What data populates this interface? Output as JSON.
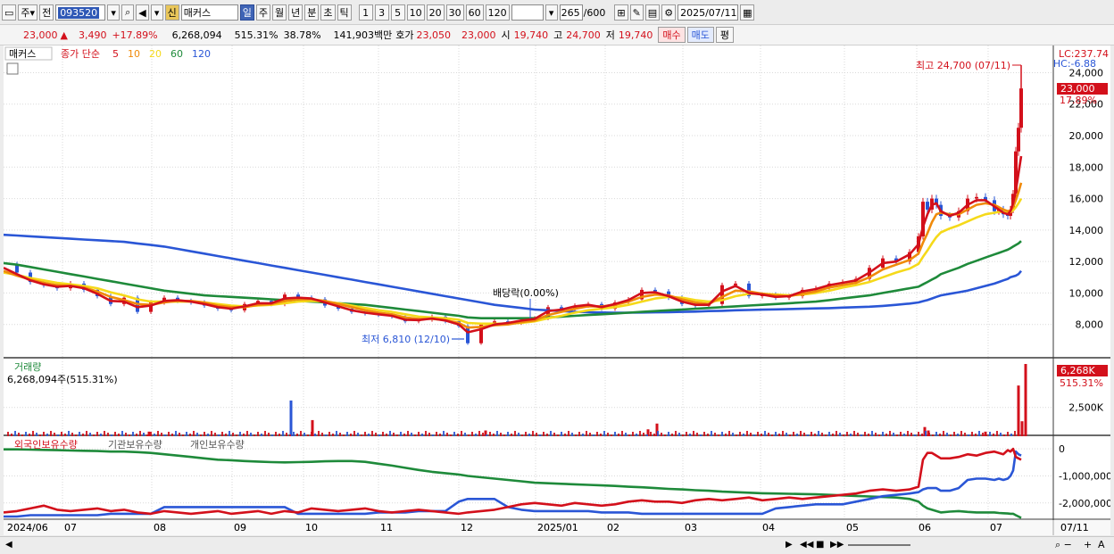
{
  "toolbar": {
    "mode": "주",
    "prev": "전",
    "code": "093520",
    "badge": "신",
    "name": "매커스",
    "periods": [
      "일",
      "주",
      "월",
      "년",
      "분",
      "초",
      "틱"
    ],
    "selected_period": "일",
    "intervals": [
      "1",
      "3",
      "5",
      "10",
      "20",
      "30",
      "60",
      "120"
    ],
    "count": "265",
    "count_max": "/600",
    "date": "2025/07/11"
  },
  "quote": {
    "price": "23,000",
    "change": "3,490",
    "change_pct": "+17.89%",
    "volume": "6,268,094",
    "vol_pct": "515.31%",
    "turnover": "38.78%",
    "amount": "141,903백만",
    "bid_label": "호가",
    "bid": "23,050",
    "ask": "23,000",
    "open_label": "시",
    "open": "19,740",
    "high_label": "고",
    "high": "24,700",
    "low_label": "저",
    "low": "19,740",
    "buy": "매수",
    "sell": "매도",
    "flat": "평"
  },
  "chart_data": {
    "type": "line",
    "price_panel": {
      "legend_name": "매커스",
      "legend_ma_title": "종가 단순",
      "ma_labels": [
        "5",
        "10",
        "20",
        "60",
        "120"
      ],
      "ma_colors": [
        "#d3101b",
        "#f08a0a",
        "#f5d91a",
        "#1e8a3a",
        "#2a56d6"
      ],
      "ylim": [
        6000,
        25500
      ],
      "y_ticks": [
        8000,
        10000,
        12000,
        14000,
        16000,
        18000,
        20000,
        22000,
        24000
      ],
      "y_tick_labels": [
        "8,000",
        "10,000",
        "12,000",
        "14,000",
        "16,000",
        "18,000",
        "20,000",
        "22,000",
        "24,000"
      ],
      "lc_label": "LC:237.74",
      "hc_label": "HC:-6.88",
      "last_price_label": "23,000",
      "last_pct_label": "17.89%",
      "high_annot": "최고 24,700 (07/11)",
      "low_annot": "최저 6,810 (12/10)",
      "div_annot": "배당락(0.00%)",
      "x": [
        0,
        15,
        30,
        45,
        60,
        75,
        90,
        105,
        120,
        135,
        150,
        165,
        180,
        195,
        210,
        225,
        240,
        255,
        270,
        285,
        300,
        315,
        330,
        345,
        360,
        375,
        390,
        405,
        420,
        435,
        450,
        465,
        480,
        495,
        510,
        520,
        535,
        550,
        565,
        580,
        595,
        610,
        625,
        640,
        655,
        670,
        685,
        700,
        715,
        730,
        745,
        760,
        775,
        790,
        805,
        820,
        835,
        850,
        865,
        880,
        895,
        910,
        925,
        940,
        955,
        970,
        985,
        1000,
        1015,
        1025,
        1030,
        1035,
        1040,
        1045,
        1050,
        1060,
        1070,
        1080,
        1090,
        1100,
        1110,
        1115,
        1120,
        1125,
        1128,
        1131,
        1134,
        1137,
        1140
      ],
      "close": [
        11800,
        11300,
        10700,
        10500,
        10300,
        10600,
        10200,
        9800,
        9300,
        9700,
        8800,
        9400,
        9700,
        9500,
        9400,
        9200,
        9000,
        8900,
        9300,
        9500,
        9300,
        9900,
        9700,
        9600,
        9200,
        9000,
        8800,
        8700,
        8600,
        8500,
        8200,
        8300,
        8500,
        8200,
        7900,
        6810,
        8000,
        8200,
        8100,
        8300,
        8400,
        9100,
        9000,
        9200,
        9300,
        9000,
        9400,
        9600,
        10200,
        10100,
        9700,
        9300,
        9200,
        9300,
        10500,
        10600,
        9800,
        9900,
        9700,
        9800,
        10200,
        10300,
        10600,
        10700,
        10900,
        11600,
        12200,
        12000,
        12600,
        13600,
        15800,
        15300,
        16000,
        15600,
        14900,
        14800,
        15200,
        16000,
        16100,
        15900,
        15200,
        15300,
        15000,
        14900,
        15300,
        16300,
        19000,
        20500,
        23000
      ],
      "ma5": [
        11600,
        11200,
        10800,
        10550,
        10400,
        10450,
        10300,
        9950,
        9500,
        9450,
        9100,
        9200,
        9500,
        9550,
        9450,
        9300,
        9100,
        9000,
        9150,
        9350,
        9350,
        9650,
        9700,
        9650,
        9400,
        9150,
        8900,
        8750,
        8650,
        8550,
        8300,
        8280,
        8380,
        8250,
        8000,
        7500,
        7700,
        8000,
        8100,
        8250,
        8350,
        8850,
        8950,
        9150,
        9250,
        9100,
        9300,
        9550,
        10000,
        10050,
        9800,
        9450,
        9250,
        9250,
        10100,
        10450,
        10000,
        9900,
        9750,
        9800,
        10100,
        10250,
        10500,
        10650,
        10800,
        11300,
        11900,
        12000,
        12450,
        13100,
        14200,
        15000,
        15600,
        15700,
        15200,
        14900,
        15100,
        15600,
        15900,
        15900,
        15500,
        15300,
        15100,
        15000,
        15200,
        15700,
        16500,
        17600,
        18700
      ],
      "ma10": [
        11400,
        11100,
        10850,
        10650,
        10500,
        10450,
        10350,
        10100,
        9750,
        9550,
        9300,
        9250,
        9400,
        9500,
        9500,
        9400,
        9200,
        9100,
        9100,
        9250,
        9300,
        9500,
        9600,
        9600,
        9500,
        9300,
        9100,
        8900,
        8750,
        8650,
        8450,
        8350,
        8350,
        8280,
        8100,
        7800,
        7850,
        7950,
        8000,
        8150,
        8250,
        8600,
        8800,
        9000,
        9150,
        9150,
        9250,
        9450,
        9750,
        9900,
        9850,
        9600,
        9400,
        9300,
        9750,
        10150,
        10100,
        9950,
        9850,
        9800,
        9950,
        10100,
        10350,
        10500,
        10650,
        11000,
        11500,
        11800,
        12100,
        12500,
        13200,
        13800,
        14500,
        15000,
        15100,
        15000,
        15000,
        15300,
        15600,
        15700,
        15600,
        15450,
        15300,
        15200,
        15250,
        15450,
        15900,
        16400,
        17000
      ],
      "ma20": [
        11300,
        11150,
        10950,
        10800,
        10650,
        10550,
        10450,
        10300,
        10050,
        9850,
        9600,
        9450,
        9450,
        9450,
        9450,
        9400,
        9300,
        9200,
        9150,
        9200,
        9250,
        9350,
        9450,
        9500,
        9450,
        9350,
        9200,
        9050,
        8900,
        8800,
        8650,
        8500,
        8450,
        8400,
        8300,
        8100,
        8050,
        8050,
        8050,
        8100,
        8200,
        8400,
        8550,
        8750,
        8900,
        9000,
        9100,
        9250,
        9450,
        9650,
        9750,
        9700,
        9550,
        9450,
        9550,
        9800,
        9950,
        9950,
        9900,
        9850,
        9900,
        10000,
        10150,
        10350,
        10500,
        10700,
        11000,
        11300,
        11550,
        11850,
        12300,
        12700,
        13150,
        13550,
        13850,
        14100,
        14300,
        14550,
        14800,
        15000,
        15100,
        15150,
        15150,
        15150,
        15150,
        15250,
        15450,
        15700,
        16000
      ],
      "ma60": [
        11900,
        11800,
        11650,
        11500,
        11350,
        11200,
        11050,
        10900,
        10750,
        10600,
        10450,
        10300,
        10150,
        10050,
        9950,
        9850,
        9800,
        9750,
        9700,
        9650,
        9600,
        9550,
        9500,
        9450,
        9400,
        9350,
        9300,
        9250,
        9150,
        9050,
        8950,
        8850,
        8750,
        8650,
        8550,
        8450,
        8400,
        8400,
        8400,
        8400,
        8400,
        8450,
        8500,
        8550,
        8600,
        8650,
        8700,
        8750,
        8800,
        8850,
        8900,
        8950,
        9000,
        9050,
        9100,
        9150,
        9200,
        9250,
        9300,
        9350,
        9400,
        9450,
        9550,
        9650,
        9750,
        9850,
        10000,
        10150,
        10300,
        10400,
        10550,
        10700,
        10850,
        11000,
        11200,
        11400,
        11600,
        11850,
        12050,
        12250,
        12450,
        12550,
        12650,
        12750,
        12850,
        12950,
        13050,
        13150,
        13300
      ],
      "ma120": [
        13700,
        13650,
        13600,
        13550,
        13500,
        13450,
        13400,
        13350,
        13300,
        13250,
        13150,
        13050,
        12950,
        12800,
        12650,
        12500,
        12350,
        12200,
        12050,
        11900,
        11750,
        11600,
        11450,
        11300,
        11150,
        11000,
        10850,
        10700,
        10550,
        10400,
        10250,
        10100,
        9950,
        9800,
        9650,
        9550,
        9400,
        9250,
        9150,
        9050,
        8950,
        8900,
        8850,
        8800,
        8780,
        8760,
        8750,
        8750,
        8760,
        8770,
        8780,
        8800,
        8820,
        8850,
        8870,
        8900,
        8920,
        8940,
        8960,
        8980,
        9000,
        9020,
        9040,
        9070,
        9100,
        9130,
        9180,
        9250,
        9330,
        9400,
        9480,
        9550,
        9650,
        9750,
        9850,
        9950,
        10050,
        10150,
        10300,
        10450,
        10600,
        10700,
        10800,
        10900,
        11000,
        11050,
        11100,
        11200,
        11400
      ]
    },
    "volume_panel": {
      "legend_name": "거래량",
      "value_label": "6,268,094주(515.31%)",
      "last_label": "6,268K",
      "last_pct_label": "515.31%",
      "ylim": [
        0,
        6500000
      ],
      "y_ticks": [
        2500000
      ],
      "y_tick_labels": [
        "2,500K"
      ],
      "spikes": [
        {
          "x": 163,
          "v": 400000
        },
        {
          "x": 322,
          "v": 3100000
        },
        {
          "x": 346,
          "v": 1400000
        },
        {
          "x": 540,
          "v": 500000
        },
        {
          "x": 722,
          "v": 600000
        },
        {
          "x": 732,
          "v": 1100000
        },
        {
          "x": 1032,
          "v": 800000
        },
        {
          "x": 1036,
          "v": 500000
        },
        {
          "x": 1100,
          "v": 400000
        },
        {
          "x": 1137,
          "v": 4400000
        },
        {
          "x": 1141,
          "v": 1300000
        },
        {
          "x": 1145,
          "v": 6268094
        }
      ]
    },
    "holdings_panel": {
      "legends": [
        "외국인보유수량",
        "기관보유수량",
        "개인보유수량"
      ],
      "legend_colors": [
        "#d3101b",
        "#2a56d6",
        "#1e8a3a"
      ],
      "ylim": [
        -2600000,
        400000
      ],
      "y_ticks": [
        0,
        -1000000,
        -2000000
      ],
      "y_tick_labels": [
        "0",
        "-1,000,000",
        "-2,000,000"
      ],
      "foreign": [
        -2350000,
        -2300000,
        -2200000,
        -2100000,
        -2250000,
        -2300000,
        -2250000,
        -2200000,
        -2300000,
        -2250000,
        -2350000,
        -2400000,
        -2300000,
        -2350000,
        -2400000,
        -2350000,
        -2300000,
        -2400000,
        -2350000,
        -2300000,
        -2400000,
        -2300000,
        -2350000,
        -2200000,
        -2250000,
        -2300000,
        -2250000,
        -2200000,
        -2300000,
        -2350000,
        -2300000,
        -2250000,
        -2300000,
        -2350000,
        -2400000,
        -2350000,
        -2300000,
        -2250000,
        -2150000,
        -2050000,
        -2000000,
        -2050000,
        -2100000,
        -2000000,
        -2050000,
        -2100000,
        -2050000,
        -1950000,
        -1900000,
        -1950000,
        -1950000,
        -2000000,
        -1900000,
        -1850000,
        -1900000,
        -1850000,
        -1800000,
        -1900000,
        -1850000,
        -1800000,
        -1850000,
        -1800000,
        -1750000,
        -1700000,
        -1650000,
        -1550000,
        -1500000,
        -1550000,
        -1500000,
        -1400000,
        -400000,
        -150000,
        -150000,
        -250000,
        -350000,
        -350000,
        -300000,
        -200000,
        -250000,
        -150000,
        -100000,
        -150000,
        -200000,
        -50000,
        -100000,
        0,
        -300000,
        -350000,
        -400000
      ],
      "institution": [
        -2500000,
        -2500000,
        -2450000,
        -2450000,
        -2450000,
        -2450000,
        -2450000,
        -2450000,
        -2400000,
        -2400000,
        -2400000,
        -2400000,
        -2150000,
        -2150000,
        -2150000,
        -2150000,
        -2150000,
        -2150000,
        -2150000,
        -2150000,
        -2150000,
        -2150000,
        -2400000,
        -2400000,
        -2400000,
        -2400000,
        -2400000,
        -2400000,
        -2350000,
        -2350000,
        -2350000,
        -2300000,
        -2300000,
        -2300000,
        -1950000,
        -1850000,
        -1850000,
        -1850000,
        -2150000,
        -2250000,
        -2300000,
        -2300000,
        -2300000,
        -2300000,
        -2300000,
        -2350000,
        -2350000,
        -2350000,
        -2400000,
        -2400000,
        -2400000,
        -2400000,
        -2400000,
        -2400000,
        -2400000,
        -2400000,
        -2400000,
        -2400000,
        -2200000,
        -2150000,
        -2100000,
        -2050000,
        -2050000,
        -2050000,
        -1950000,
        -1850000,
        -1750000,
        -1700000,
        -1650000,
        -1600000,
        -1500000,
        -1450000,
        -1450000,
        -1450000,
        -1550000,
        -1550000,
        -1450000,
        -1150000,
        -1100000,
        -1100000,
        -1150000,
        -1100000,
        -1150000,
        -1100000,
        -1000000,
        -800000,
        -100000,
        -200000,
        -250000
      ],
      "individual": [
        -20000,
        -20000,
        -30000,
        -40000,
        -50000,
        -60000,
        -70000,
        -80000,
        -100000,
        -100000,
        -120000,
        -150000,
        -200000,
        -250000,
        -300000,
        -350000,
        -400000,
        -420000,
        -450000,
        -470000,
        -490000,
        -500000,
        -490000,
        -480000,
        -460000,
        -450000,
        -450000,
        -480000,
        -550000,
        -620000,
        -700000,
        -780000,
        -850000,
        -900000,
        -950000,
        -1000000,
        -1050000,
        -1100000,
        -1150000,
        -1200000,
        -1250000,
        -1270000,
        -1290000,
        -1310000,
        -1330000,
        -1350000,
        -1370000,
        -1400000,
        -1420000,
        -1450000,
        -1480000,
        -1500000,
        -1530000,
        -1550000,
        -1580000,
        -1600000,
        -1620000,
        -1640000,
        -1650000,
        -1660000,
        -1670000,
        -1680000,
        -1700000,
        -1720000,
        -1740000,
        -1760000,
        -1780000,
        -1800000,
        -1850000,
        -1950000,
        -2100000,
        -2200000,
        -2250000,
        -2300000,
        -2350000,
        -2320000,
        -2300000,
        -2330000,
        -2350000,
        -2350000,
        -2350000,
        -2370000,
        -2380000,
        -2390000,
        -2400000,
        -2400000,
        -2450000,
        -2500000,
        -2550000
      ]
    },
    "x_ticks": [
      {
        "x": 2,
        "label": "2024/06"
      },
      {
        "x": 66,
        "label": "07"
      },
      {
        "x": 166,
        "label": "08"
      },
      {
        "x": 256,
        "label": "09"
      },
      {
        "x": 336,
        "label": "10"
      },
      {
        "x": 420,
        "label": "11"
      },
      {
        "x": 510,
        "label": "12"
      },
      {
        "x": 596,
        "label": "2025/01"
      },
      {
        "x": 674,
        "label": "02"
      },
      {
        "x": 761,
        "label": "03"
      },
      {
        "x": 848,
        "label": "04"
      },
      {
        "x": 942,
        "label": "05"
      },
      {
        "x": 1023,
        "label": "06"
      },
      {
        "x": 1103,
        "label": "07"
      },
      {
        "x": 1182,
        "label": "07/11"
      }
    ]
  }
}
